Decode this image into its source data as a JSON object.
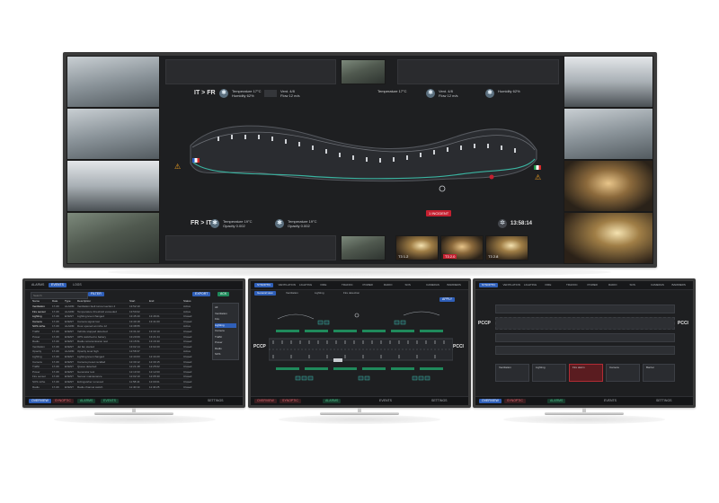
{
  "main_monitor": {
    "directions": {
      "top_left": "IT > FR",
      "bottom_left": "FR > IT"
    },
    "clock": "13:58:14",
    "alert_badge": "1 INCIDENT",
    "readouts_top_left": [
      "Temperature 17°C",
      "Humidity 62%"
    ],
    "readouts_top_right": [
      "Vent. 4/8",
      "Flow 12 m/s"
    ],
    "readouts_bottom": [
      "Temperature 19°C",
      "Opacity 0.002"
    ],
    "cam_captions": [
      "T3 1.2",
      "T3 2.0",
      "T3 2.8"
    ]
  },
  "monitor_a": {
    "tabs": [
      "ALARMS",
      "EVENTS",
      "LOGS"
    ],
    "search_placeholder": "Search",
    "filter_button": "FILTER",
    "action_buttons": [
      "EXPORT",
      "ACK"
    ],
    "columns": [
      "Name",
      "Date",
      "Type",
      "Description",
      "Start",
      "End",
      "Status"
    ],
    "rows": [
      [
        "Ventilation",
        "17-09",
        "ALARM",
        "Ventilation fault tunnel section 4",
        "13:52:10",
        "",
        "Active"
      ],
      [
        "Fire sensor",
        "17-09",
        "ALARM",
        "Temperature threshold exceeded",
        "13:50:02",
        "",
        "Active"
      ],
      [
        "Lighting",
        "17-09",
        "EVENT",
        "Lighting level changed",
        "13:45:40",
        "13:46:01",
        "Closed"
      ],
      [
        "Camera",
        "17-09",
        "EVENT",
        "Camera signal lost",
        "13:40:18",
        "13:41:00",
        "Closed"
      ],
      [
        "SOS niche",
        "17-09",
        "ALARM",
        "Door opened at niche 12",
        "13:38:55",
        "",
        "Active"
      ],
      [
        "Traffic",
        "17-09",
        "EVENT",
        "Vehicle stopped detected",
        "13:31:22",
        "13:33:10",
        "Closed"
      ],
      [
        "Power",
        "17-09",
        "EVENT",
        "UPS switched to battery",
        "13:20:09",
        "13:21:44",
        "Closed"
      ],
      [
        "Radio",
        "17-09",
        "EVENT",
        "Radio retransmission test",
        "13:15:51",
        "13:16:30",
        "Closed"
      ],
      [
        "Ventilation",
        "17-09",
        "EVENT",
        "Jet fan started",
        "13:02:14",
        "13:02:20",
        "Closed"
      ],
      [
        "Opacity",
        "17-09",
        "ALARM",
        "Opacity level high",
        "12:58:37",
        "",
        "Active"
      ],
      [
        "Lighting",
        "17-09",
        "EVENT",
        "Lighting level changed",
        "12:44:03",
        "12:44:20",
        "Closed"
      ],
      [
        "Camera",
        "17-09",
        "EVENT",
        "Camera preset recalled",
        "12:30:12",
        "12:30:15",
        "Closed"
      ],
      [
        "Traffic",
        "17-09",
        "EVENT",
        "Queue detected",
        "12:21:48",
        "12:25:02",
        "Closed"
      ],
      [
        "Power",
        "17-09",
        "EVENT",
        "Generator test",
        "12:10:33",
        "12:12:00",
        "Closed"
      ],
      [
        "Fire sensor",
        "17-09",
        "EVENT",
        "Sensor maintenance",
        "12:02:10",
        "12:05:30",
        "Closed"
      ],
      [
        "SOS niche",
        "17-09",
        "EVENT",
        "Extinguisher removed",
        "11:58:44",
        "12:00:01",
        "Closed"
      ],
      [
        "Radio",
        "17-09",
        "EVENT",
        "Radio channel switch",
        "11:40:19",
        "11:40:25",
        "Closed"
      ]
    ],
    "dropdown": [
      "All",
      "Ventilation",
      "Fire",
      "Lighting",
      "Camera",
      "Traffic",
      "Power",
      "Radio",
      "SOS"
    ],
    "bottom_buttons": [
      "OVERVIEW",
      "SYNOPTIC",
      "ALARMS",
      "EVENTS",
      "SETTINGS"
    ]
  },
  "monitor_b": {
    "tabs": [
      "SYNOPTIC",
      "VENTILATION",
      "LIGHTING",
      "FIRE",
      "TRAFFIC",
      "POWER",
      "RADIO",
      "SOS",
      "CAMERAS",
      "BARRIERS"
    ],
    "sub_tabs": [
      "General view",
      "Ventilation",
      "Lighting",
      "Fire detection"
    ],
    "action_button": "APPLY",
    "left_label": "PCCP",
    "right_label": "PCCI",
    "bottom_buttons": [
      "OVERVIEW",
      "SYNOPTIC",
      "ALARMS",
      "EVENTS",
      "SETTINGS"
    ]
  },
  "monitor_c": {
    "tabs": [
      "SYNOPTIC",
      "VENTILATION",
      "LIGHTING",
      "FIRE",
      "TRAFFIC",
      "POWER",
      "RADIO",
      "SOS",
      "CAMERAS",
      "BARRIERS"
    ],
    "left_label": "PCCP",
    "right_label": "PCCI",
    "cells": [
      "Ventilation",
      "Lighting",
      "Fire alarm",
      "Camera",
      "Barrier"
    ],
    "bottom_buttons": [
      "OVERVIEW",
      "SYNOPTIC",
      "ALARMS",
      "EVENTS",
      "SETTINGS"
    ]
  },
  "colors": {
    "accent_blue": "#2f5fb8",
    "alert_red": "#c42030",
    "teal": "#3ab3a0",
    "warning": "#f0a020"
  }
}
